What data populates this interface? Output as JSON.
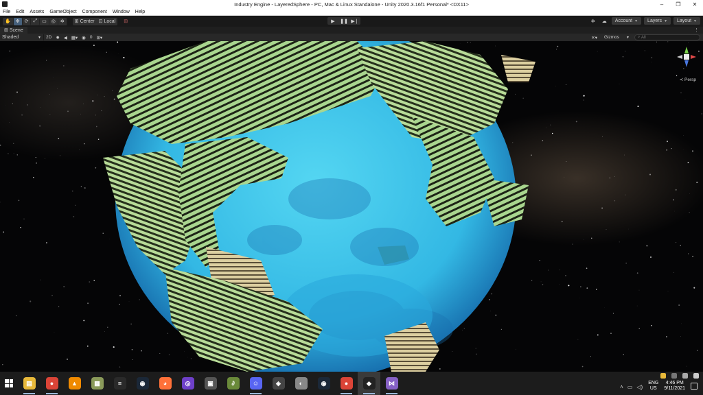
{
  "window": {
    "title": "Industry Engine - LayeredSphere - PC, Mac & Linux Standalone - Unity 2020.3.16f1 Personal* <DX11>",
    "controls": [
      "–",
      "❐",
      "✕"
    ]
  },
  "menu": [
    "File",
    "Edit",
    "Assets",
    "GameObject",
    "Component",
    "Window",
    "Help"
  ],
  "toolbar": {
    "tools": [
      "✋",
      "✥",
      "⟳",
      "⤢",
      "▭",
      "◎",
      "✲"
    ],
    "pivot": "Center",
    "space": "Local",
    "play": [
      "▶",
      "❚❚",
      "▶❘"
    ],
    "account": "Account",
    "layers": "Layers",
    "layout": "Layout"
  },
  "scene_tab": {
    "label": "Scene",
    "more": "⋮"
  },
  "scene_toolbar": {
    "shading": "Shaded",
    "mode_2d": "2D",
    "gizmo_count": "0",
    "gizmos": "Gizmos",
    "search_placeholder": "All"
  },
  "viewport": {
    "projection": "Persp",
    "colors": {
      "ocean": "#3fc8e8",
      "ocean_dark": "#1c7fb8",
      "land": "#9fd08a",
      "land_dark": "#3a4a2c",
      "sand": "#e0d6a8"
    }
  },
  "taskbar": {
    "apps": [
      {
        "name": "file-explorer",
        "glyph": "▤",
        "color": "#e8b93a",
        "running": true
      },
      {
        "name": "chrome",
        "glyph": "●",
        "color": "#db4437",
        "running": true
      },
      {
        "name": "vlc",
        "glyph": "▲",
        "color": "#f08a00",
        "running": false
      },
      {
        "name": "minecraft",
        "glyph": "▦",
        "color": "#8a9a5a",
        "running": false
      },
      {
        "name": "epic-games",
        "glyph": "≡",
        "color": "#2a2a2a",
        "running": false
      },
      {
        "name": "steam",
        "glyph": "◉",
        "color": "#1b2838",
        "running": false
      },
      {
        "name": "firefox",
        "glyph": "◕",
        "color": "#ff7139",
        "running": false
      },
      {
        "name": "github-desktop",
        "glyph": "◎",
        "color": "#6e40c9",
        "running": false
      },
      {
        "name": "app-window",
        "glyph": "▣",
        "color": "#555555",
        "running": false
      },
      {
        "name": "greenshot",
        "glyph": "∂",
        "color": "#6a8a3a",
        "running": false
      },
      {
        "name": "discord",
        "glyph": "☺",
        "color": "#5865f2",
        "running": true
      },
      {
        "name": "unity-hub",
        "glyph": "◈",
        "color": "#444444",
        "running": false
      },
      {
        "name": "maps",
        "glyph": "◐",
        "color": "#888888",
        "running": false
      },
      {
        "name": "steam-2",
        "glyph": "◉",
        "color": "#1b2838",
        "running": false
      },
      {
        "name": "chrome-2",
        "glyph": "●",
        "color": "#db4437",
        "running": true
      },
      {
        "name": "unity",
        "glyph": "◆",
        "color": "#222222",
        "running": true,
        "focused": true
      },
      {
        "name": "visual-studio",
        "glyph": "⋈",
        "color": "#8661c5",
        "running": true
      }
    ],
    "language": "ENG",
    "region": "US",
    "time": "4:46 PM",
    "date": "9/11/2021"
  }
}
